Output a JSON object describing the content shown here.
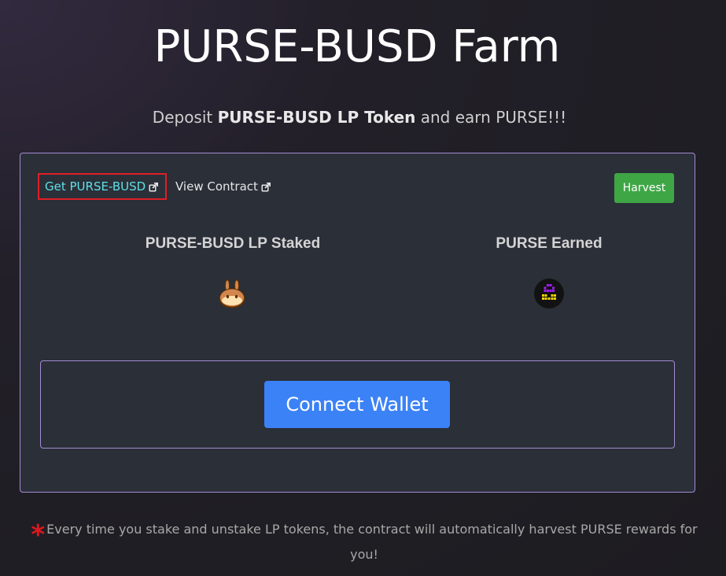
{
  "page": {
    "title": "PURSE-BUSD Farm",
    "subtitle_prefix": "Deposit ",
    "subtitle_bold": "PURSE-BUSD LP Token",
    "subtitle_suffix": " and earn PURSE!!!"
  },
  "card": {
    "get_link_label": "Get PURSE-BUSD",
    "view_contract_label": "View Contract",
    "harvest_label": "Harvest",
    "staked_title": "PURSE-BUSD LP Staked",
    "earned_title": "PURSE Earned",
    "staked_icon": "pancakeswap-bunny-icon",
    "earned_icon": "purse-token-icon",
    "connect_wallet_label": "Connect Wallet"
  },
  "footer": {
    "asterisk": "*",
    "note": "Every time you stake and unstake LP tokens, the contract will automatically harvest PURSE rewards for you!"
  },
  "colors": {
    "accent_border": "#a68bd4",
    "link_cyan": "#5fe0e6",
    "harvest_green": "#3fa646",
    "connect_blue": "#3b82f6",
    "highlight_red": "#e01f27"
  }
}
